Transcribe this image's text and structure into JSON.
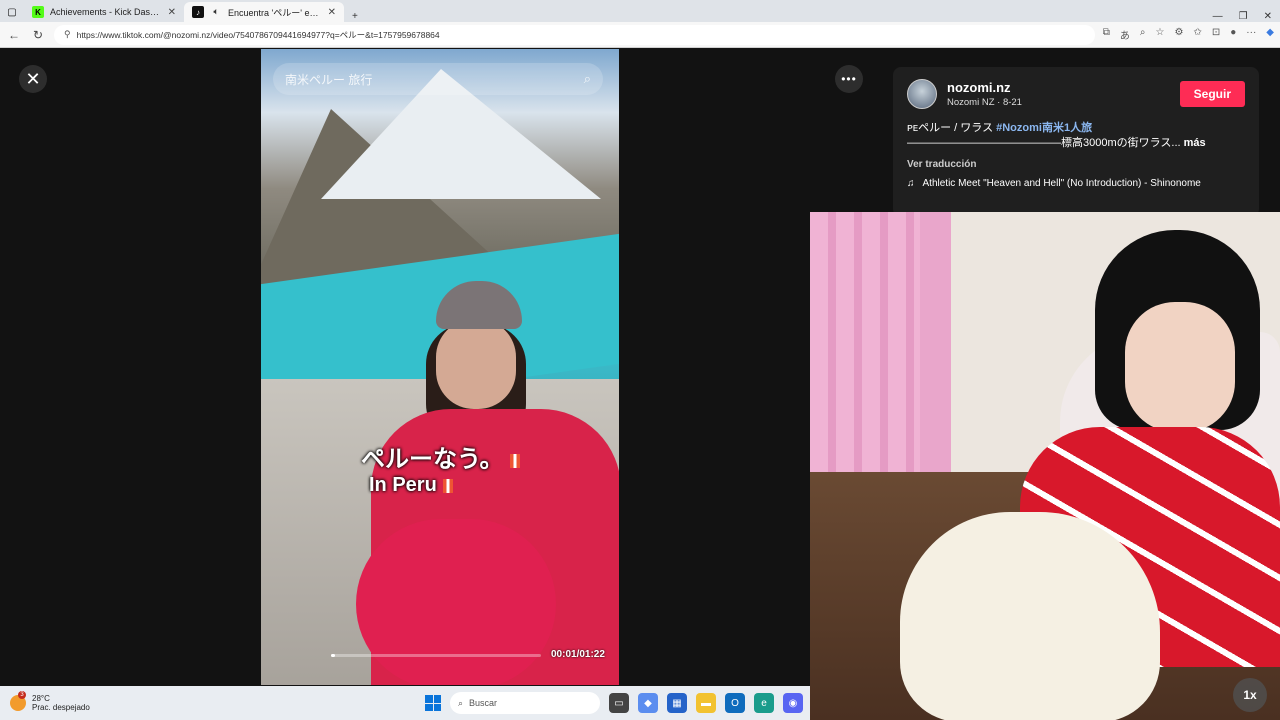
{
  "tabs": [
    {
      "title": "Achievements - Kick Dashboard",
      "favicon": "K",
      "color": "#53fc18",
      "active": false
    },
    {
      "title": "Encuentra 'ペルー' en TikTok |",
      "favicon": "♪",
      "color": "#111111",
      "active": true
    }
  ],
  "address": {
    "url": "https://www.tiktok.com/@nozomi.nz/video/7540786709441694977?q=ペルー&t=1757959678864"
  },
  "video": {
    "search_placeholder": "南米ペルー 旅行",
    "caption_line1": "ペルーなう。",
    "caption_line2": "In Peru",
    "time": "00:01/01:22",
    "progress": 0.01
  },
  "info": {
    "username": "nozomi.nz",
    "subtitle": "Nozomi NZ · 8-21",
    "follow_label": "Seguir",
    "desc_prefix": "ᴘᴇペルー / ワラス ",
    "desc_tag": "#Nozomi南米1人旅",
    "desc_line2": "——————————————標高3000mの街ワラス...",
    "desc_more": "más",
    "translate_label": "Ver traducción",
    "music": "Athletic Meet \"Heaven and Hell\" (No Introduction) - Shinonome"
  },
  "webcam": {
    "speed_label": "1x"
  },
  "taskbar": {
    "temperature": "28°C",
    "weather": "Prac. despejado",
    "badge": "3",
    "search_placeholder": "Buscar"
  }
}
